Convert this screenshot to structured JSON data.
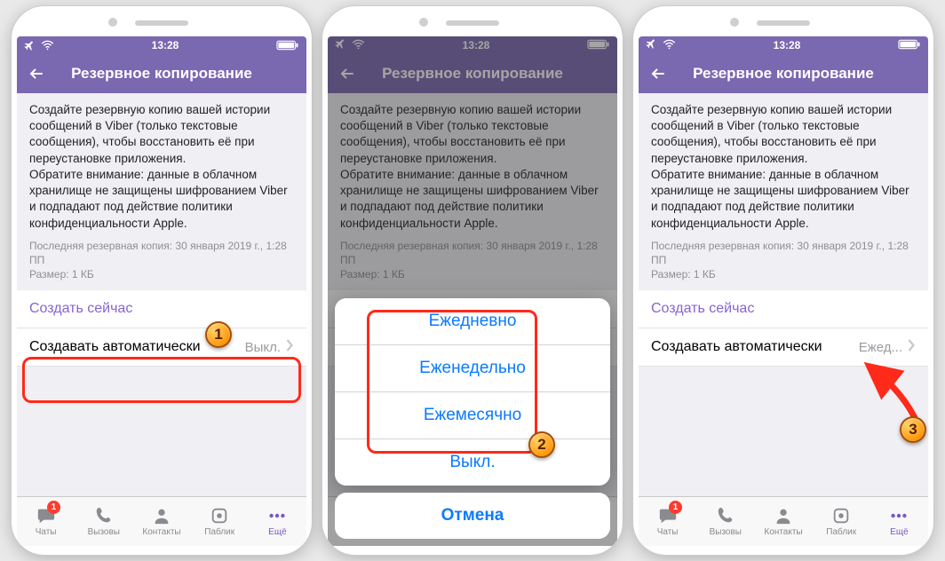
{
  "status": {
    "time": "13:28"
  },
  "nav": {
    "title": "Резервное копирование"
  },
  "desc": "Создайте резервную копию вашей истории сообщений в Viber (только текстовые сообщения), чтобы восстановить её при переустановке приложения.\nОбратите внимание: данные в облачном хранилище не защищены шифрованием Viber и подпадают под действие политики конфиденциальности Apple.",
  "meta": {
    "last": "Последняя резервная копия: 30 января 2019 г., 1:28 ПП",
    "size": "Размер: 1 КБ"
  },
  "rows": {
    "create_now": "Создать сейчас",
    "auto_label": "Создавать автоматически"
  },
  "auto_value_off": "Выкл.",
  "auto_value_daily": "Ежед...",
  "sheet": {
    "daily": "Ежедневно",
    "weekly": "Еженедельно",
    "monthly": "Ежемесячно",
    "off": "Выкл.",
    "cancel": "Отмена"
  },
  "tabs": {
    "chats": "Чаты",
    "calls": "Вызовы",
    "contacts": "Контакты",
    "public": "Паблик",
    "more": "Ещё",
    "badge": "1"
  },
  "steps": {
    "s1": "1",
    "s2": "2",
    "s3": "3"
  }
}
